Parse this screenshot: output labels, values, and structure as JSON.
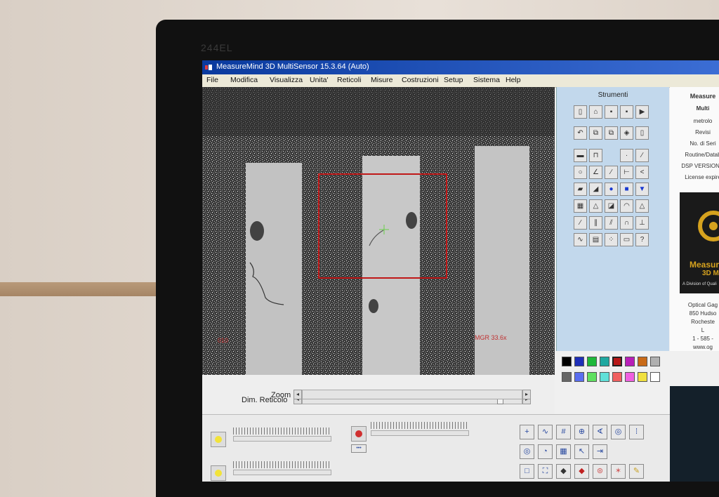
{
  "monitor": {
    "model": "244EL"
  },
  "window": {
    "title": "MeasureMind 3D MultiSensor 15.3.64 (Auto)"
  },
  "menu": [
    "File",
    "Modifica",
    "Visualizza",
    "Unita'",
    "Reticoli",
    "Misure",
    "Costruzioni",
    "Setup",
    "Sistema",
    "Help"
  ],
  "camera": {
    "overlay_left": "        010",
    "overlay_right": "MGR 33.6x"
  },
  "tools": {
    "title": "Strumenti"
  },
  "info": {
    "lines": [
      "Measure",
      "Multi",
      "metrolo",
      "Revisi",
      "No. di Seri",
      "Routine/Datab",
      "DSP VERSION 6",
      "License expire"
    ],
    "logo_name": "Measur",
    "logo_sub": "3D M",
    "logo_tag": "A Division of Quali",
    "contact": [
      "Optical Gag",
      "850 Hudso",
      "Rocheste",
      "L",
      "1 - 585 -",
      "www.og"
    ]
  },
  "sliders": {
    "reticolo_label": "Dim. Reticolo",
    "zoom_label": "Zoom"
  },
  "lower": {
    "button_dots": "•••"
  },
  "colors": {
    "palette_top": [
      "#000000",
      "#1f2fb8",
      "#1fb83a",
      "#20a8a0",
      "#b81818",
      "#b81fb8",
      "#c86a18",
      "#b0b0b0"
    ],
    "palette_bottom": [
      "#666666",
      "#5a6ef0",
      "#60e060",
      "#60e0d8",
      "#f06060",
      "#f060e0",
      "#f0e040",
      "#ffffff"
    ]
  }
}
